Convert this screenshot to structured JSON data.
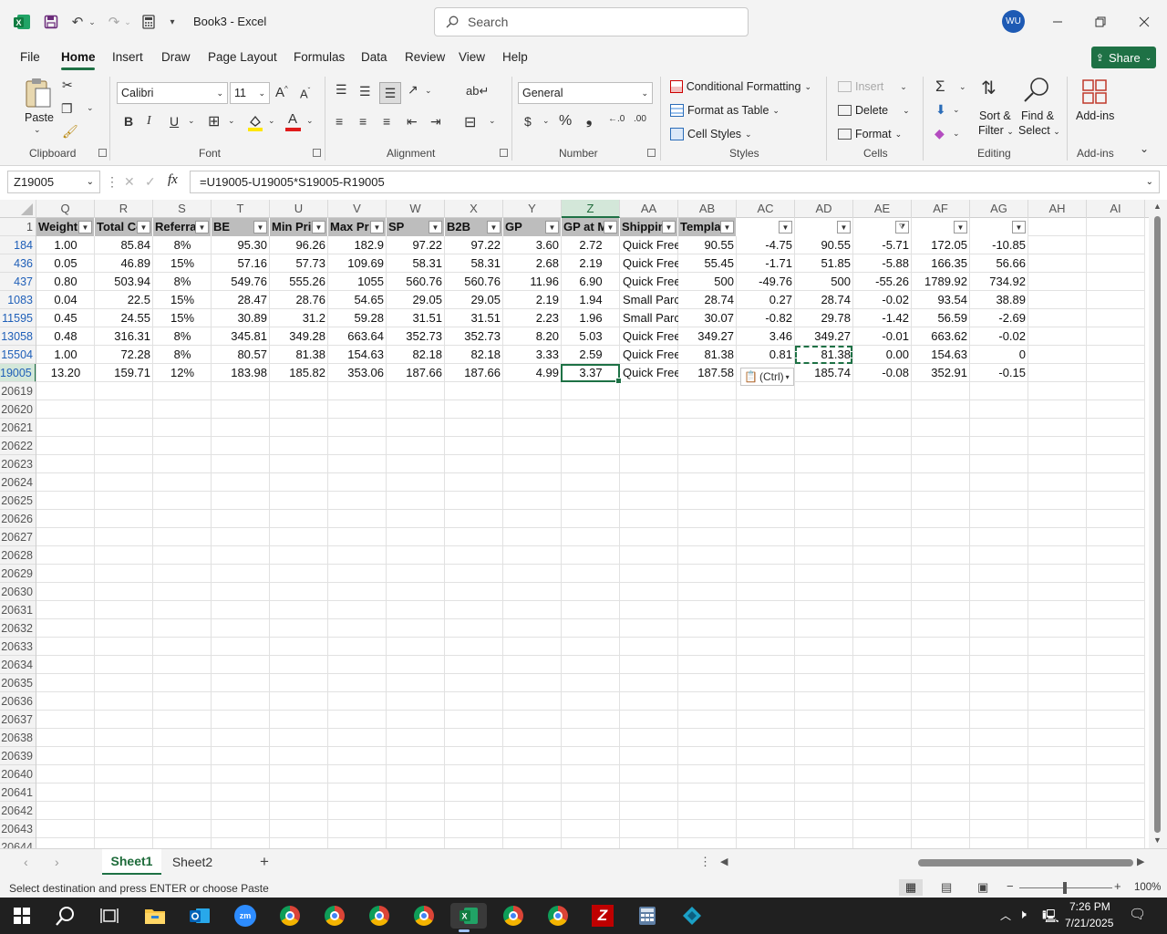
{
  "app": {
    "title": "Book3 - Excel",
    "search_placeholder": "Search",
    "avatar_initials": "WU"
  },
  "menu": {
    "items": [
      "File",
      "Home",
      "Insert",
      "Draw",
      "Page Layout",
      "Formulas",
      "Data",
      "Review",
      "View",
      "Help"
    ],
    "active": "Home",
    "share_label": "Share"
  },
  "ribbon": {
    "clipboard": {
      "label": "Clipboard",
      "paste": "Paste"
    },
    "font": {
      "label": "Font",
      "name": "Calibri",
      "size": "11"
    },
    "alignment": {
      "label": "Alignment"
    },
    "number": {
      "label": "Number",
      "format": "General"
    },
    "styles": {
      "label": "Styles",
      "conditional": "Conditional Formatting",
      "table": "Format as Table",
      "cellstyles": "Cell Styles"
    },
    "cells": {
      "label": "Cells",
      "insert": "Insert",
      "delete": "Delete",
      "format": "Format"
    },
    "editing": {
      "label": "Editing",
      "sort": "Sort &",
      "sort2": "Filter",
      "find": "Find &",
      "find2": "Select"
    },
    "addins": {
      "label": "Add-ins",
      "btn": "Add-ins"
    }
  },
  "formula_bar": {
    "name_box": "Z19005",
    "formula": "=U19005-U19005*S19005-R19005"
  },
  "grid": {
    "columns": [
      "Q",
      "R",
      "S",
      "T",
      "U",
      "V",
      "W",
      "X",
      "Y",
      "Z",
      "AA",
      "AB",
      "AC",
      "AD",
      "AE",
      "AF",
      "AG",
      "AH",
      "AI"
    ],
    "selected_column": "Z",
    "header_row_number": "1",
    "headers": [
      "Weight",
      "Total Co",
      "Referral",
      "BE",
      "Min Pri",
      "Max Pr",
      "SP",
      "B2B",
      "GP",
      "GP at M",
      "Shippin",
      "Templat",
      "",
      "",
      "",
      "",
      ""
    ],
    "filtered_column": "AE",
    "data_row_numbers": [
      "184",
      "436",
      "437",
      "1083",
      "11595",
      "13058",
      "15504",
      "19005"
    ],
    "selected_row": "19005",
    "rows": [
      [
        "1.00",
        "85.84",
        "8%",
        "95.30",
        "96.26",
        "182.9",
        "97.22",
        "97.22",
        "3.60",
        "2.72",
        "Quick Free",
        "90.55",
        "-4.75",
        "90.55",
        "-5.71",
        "172.05",
        "-10.85"
      ],
      [
        "0.05",
        "46.89",
        "15%",
        "57.16",
        "57.73",
        "109.69",
        "58.31",
        "58.31",
        "2.68",
        "2.19",
        "Quick Free",
        "55.45",
        "-1.71",
        "51.85",
        "-5.88",
        "166.35",
        "56.66"
      ],
      [
        "0.80",
        "503.94",
        "8%",
        "549.76",
        "555.26",
        "1055",
        "560.76",
        "560.76",
        "11.96",
        "6.90",
        "Quick Free",
        "500",
        "-49.76",
        "500",
        "-55.26",
        "1789.92",
        "734.92"
      ],
      [
        "0.04",
        "22.5",
        "15%",
        "28.47",
        "28.76",
        "54.65",
        "29.05",
        "29.05",
        "2.19",
        "1.94",
        "Small Parc",
        "28.74",
        "0.27",
        "28.74",
        "-0.02",
        "93.54",
        "38.89"
      ],
      [
        "0.45",
        "24.55",
        "15%",
        "30.89",
        "31.2",
        "59.28",
        "31.51",
        "31.51",
        "2.23",
        "1.96",
        "Small Parc",
        "30.07",
        "-0.82",
        "29.78",
        "-1.42",
        "56.59",
        "-2.69"
      ],
      [
        "0.48",
        "316.31",
        "8%",
        "345.81",
        "349.28",
        "663.64",
        "352.73",
        "352.73",
        "8.20",
        "5.03",
        "Quick Free",
        "349.27",
        "3.46",
        "349.27",
        "-0.01",
        "663.62",
        "-0.02"
      ],
      [
        "1.00",
        "72.28",
        "8%",
        "80.57",
        "81.38",
        "154.63",
        "82.18",
        "82.18",
        "3.33",
        "2.59",
        "Quick Free",
        "81.38",
        "0.81",
        "81.38",
        "0.00",
        "154.63",
        "0"
      ],
      [
        "13.20",
        "159.71",
        "12%",
        "183.98",
        "185.82",
        "353.06",
        "187.66",
        "187.66",
        "4.99",
        "3.37",
        "Quick Free",
        "187.58",
        "",
        "185.74",
        "-0.08",
        "352.91",
        "-0.15"
      ]
    ],
    "empty_row_numbers": [
      "20619",
      "20620",
      "20621",
      "20622",
      "20623",
      "20624",
      "20625",
      "20626",
      "20627",
      "20628",
      "20629",
      "20630",
      "20631",
      "20632",
      "20633",
      "20634",
      "20635",
      "20636",
      "20637",
      "20638",
      "20639",
      "20640",
      "20641",
      "20642",
      "20643",
      "20644"
    ],
    "paste_options": "(Ctrl)"
  },
  "sheets": {
    "tabs": [
      "Sheet1",
      "Sheet2"
    ],
    "active": "Sheet1"
  },
  "status": {
    "message": "Select destination and press ENTER or choose Paste",
    "zoom": "100%"
  },
  "taskbar": {
    "time": "7:26 PM",
    "date": "7/21/2025"
  }
}
